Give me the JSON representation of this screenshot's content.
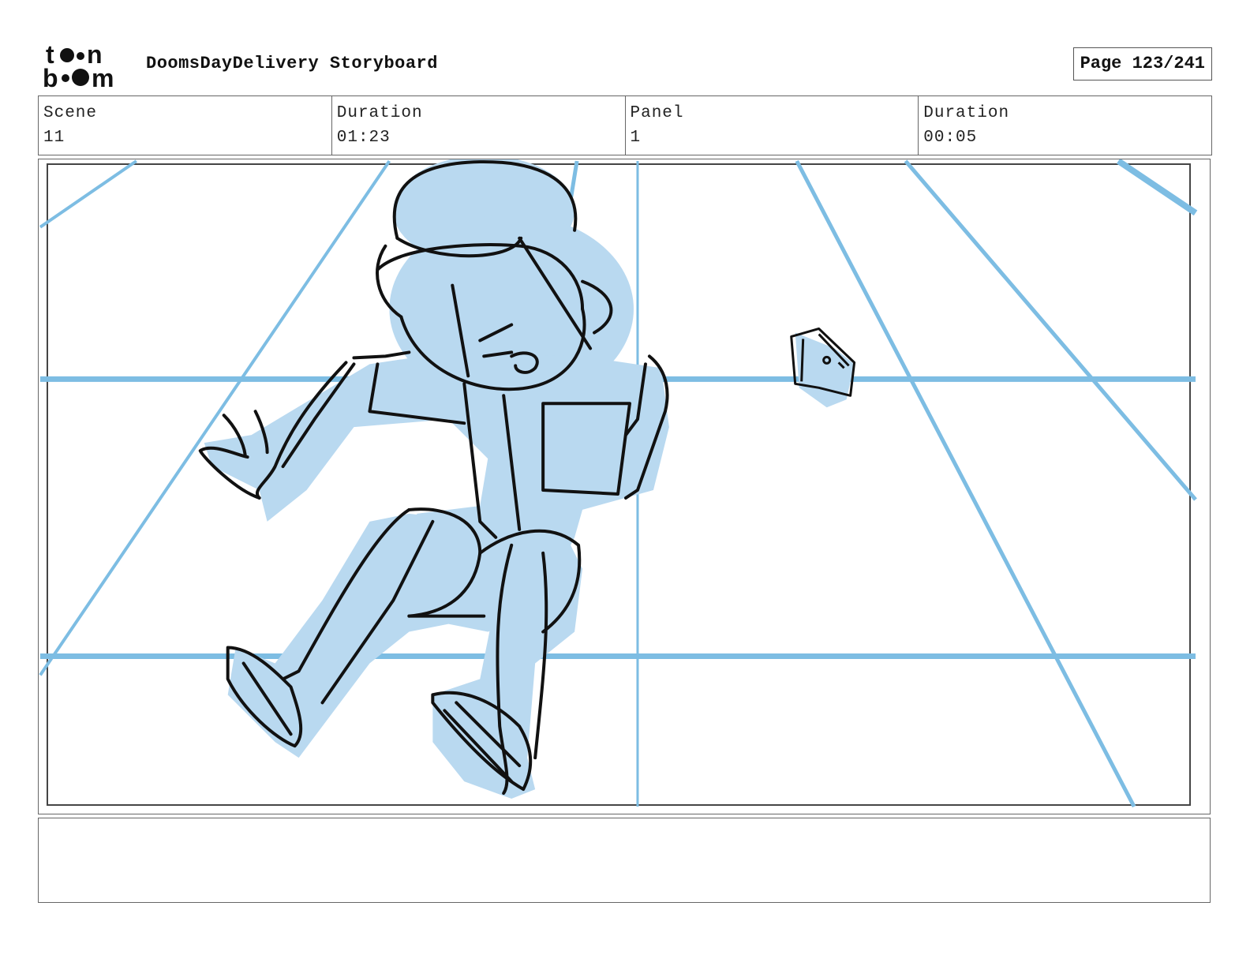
{
  "header": {
    "logo_text_top": "toon",
    "logo_text_bottom": "boom",
    "title": "DoomsDayDelivery Storyboard",
    "page_label": "Page 123/241"
  },
  "info": {
    "scene_label": "Scene",
    "scene_value": "11",
    "scene_duration_label": "Duration",
    "scene_duration_value": "01:23",
    "panel_label": "Panel",
    "panel_value": "1",
    "panel_duration_label": "Duration",
    "panel_duration_value": "00:05"
  },
  "notes": {
    "text": ""
  },
  "colors": {
    "sketch_fill": "#b9d9f0",
    "guide_lines": "#7dbde3",
    "ink": "#111111"
  }
}
